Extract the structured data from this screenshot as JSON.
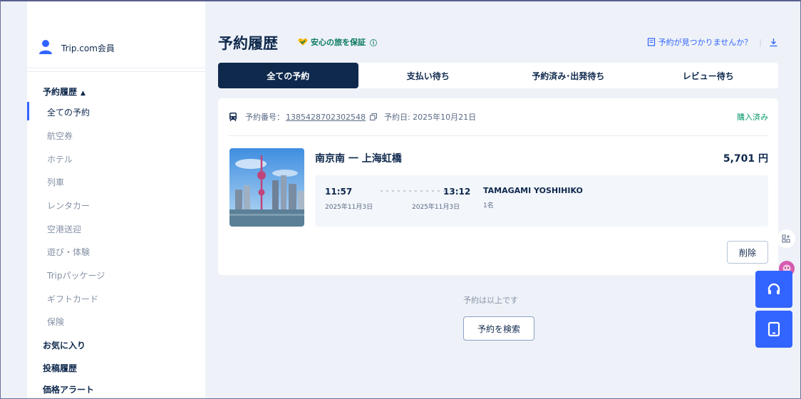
{
  "sidebar": {
    "member_label": "Trip.com会員",
    "section_bookings": "予約履歴",
    "section_bookings_caret": "▲",
    "items": [
      {
        "label": "全ての予約"
      },
      {
        "label": "航空券"
      },
      {
        "label": "ホテル"
      },
      {
        "label": "列車"
      },
      {
        "label": "レンタカー"
      },
      {
        "label": "空港送迎"
      },
      {
        "label": "遊び・体験"
      },
      {
        "label": "Tripパッケージ"
      },
      {
        "label": "ギフトカード"
      },
      {
        "label": "保険"
      }
    ],
    "favorites": "お気に入り",
    "posts": "投稿履歴",
    "price_alert": "価格アラート"
  },
  "header": {
    "title": "予約履歴",
    "guarantee": "安心の旅を保証",
    "guarantee_info": "ⓘ",
    "not_found": "予約が見つかりませんか？",
    "separator": "|"
  },
  "tabs": [
    {
      "label": "全ての予約",
      "active": true
    },
    {
      "label": "支払い待ち"
    },
    {
      "label": "予約済み･出発待ち"
    },
    {
      "label": "レビュー待ち"
    }
  ],
  "order": {
    "number_label": "予約番号：",
    "number": "1385428702302548",
    "date_label": "予約日: 2025年10月21日",
    "status": "購入済み",
    "route": "南京南 一 上海虹橋",
    "price": "5,701 円",
    "depart_time": "11:57",
    "depart_date": "2025年11月3日",
    "arrive_time": "13:12",
    "arrive_date": "2025年11月3日",
    "passenger": "TAMAGAMI YOSHIHIKO",
    "passenger_count": "1名",
    "delete_label": "削除"
  },
  "footer": {
    "end_text": "予約は以上です",
    "search_label": "予約を検索"
  },
  "colors": {
    "navy": "#0f294d",
    "accent_blue": "#3264ff",
    "status_green": "#0a9b6e",
    "guarantee_green": "#0a7a60"
  },
  "icons": [
    "user-icon",
    "heart-shield-icon",
    "info-icon",
    "document-icon",
    "download-icon",
    "train-icon",
    "copy-icon",
    "grid-icon",
    "headset-icon",
    "tablet-icon"
  ]
}
